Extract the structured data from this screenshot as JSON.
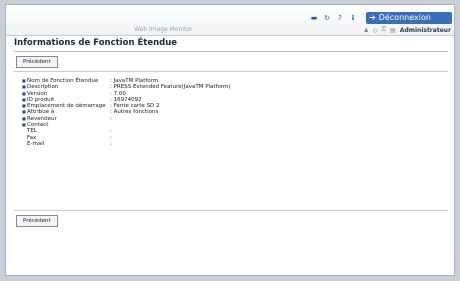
{
  "header": {
    "app_title": "Web Image Monitor",
    "logout_label": "Déconnexion",
    "user_label": "Administrateur",
    "icons": [
      "home-icon",
      "refresh-icon",
      "help-icon",
      "info-icon"
    ]
  },
  "page": {
    "title": "Informations de Fonction Étendue",
    "back_button_label": "Précédent"
  },
  "info": [
    {
      "label": "Nom de Fonction Étendue",
      "value": ": JavaTM Platform"
    },
    {
      "label": "Description",
      "value": ": PRESS Extended Feature(JavaTM Platform)"
    },
    {
      "label": "Version",
      "value": ": 7.00"
    },
    {
      "label": "ID produit",
      "value": ": 16974092"
    },
    {
      "label": "Emplacement de démarrage",
      "value": ": Fente carte SD 2"
    },
    {
      "label": "Attribué à",
      "value": ": Autres fonctions"
    },
    {
      "label": "Revendeur",
      "value": ":"
    },
    {
      "label": "Contact",
      "value": ""
    },
    {
      "label": "TEL",
      "value": ":"
    },
    {
      "label": "Fax",
      "value": ":"
    },
    {
      "label": "E-mail",
      "value": ":"
    }
  ]
}
